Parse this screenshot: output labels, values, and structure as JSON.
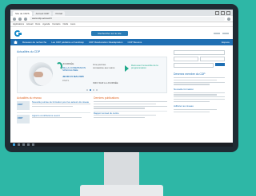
{
  "browser": {
    "tabs": [
      "Site de l'ARS",
      "Accueil CDP",
      "Portail"
    ],
    "url": "www.cdp-accueil.fr",
    "bookmarks": [
      "Applications",
      "Accueil",
      "Docs",
      "Agenda",
      "Contacts",
      "Outils",
      "Liens"
    ]
  },
  "site": {
    "search_label": "Rechercher sur le site",
    "nav": [
      "Réseaux de recherche",
      "Les CDP pédiatrie et handicap",
      "CDP Rééducation Réadaptation",
      "CDP Besoins"
    ],
    "nav_right": "Espace"
  },
  "hero": {
    "section_title": "Actualités du CDP",
    "event_label": "JOURNÉE",
    "event_title_1": "DE LA COMMISSION",
    "event_title_2": "SPÉCIALISÉE",
    "date": "JEUDI 15 MAI 2025",
    "date_sub": "PARIS",
    "mid_text": "Une journée consacrée aux soins",
    "mid_sub": "INFO SUR LA JOURNÉE",
    "right_text": "Retrouvez l'ensemble de la programmation",
    "dots_count": 4,
    "active_dot": 1
  },
  "sidebar": {
    "title": "Devenez membre du CDP",
    "sub_title": "Nouvelle formation",
    "sub_title_2": "Adhérer au réseau"
  },
  "columns": {
    "news_title": "Actualités du réseau",
    "news_items": [
      {
        "tag": "CDP",
        "title": "Nouvelle journée de formation pour les acteurs du réseau"
      },
      {
        "tag": "CDP",
        "title": "Appel à contributions ouvert"
      }
    ],
    "events_title": "Derniers publications",
    "events_items": [
      {
        "title": "Rapport annuel du centre"
      }
    ]
  }
}
